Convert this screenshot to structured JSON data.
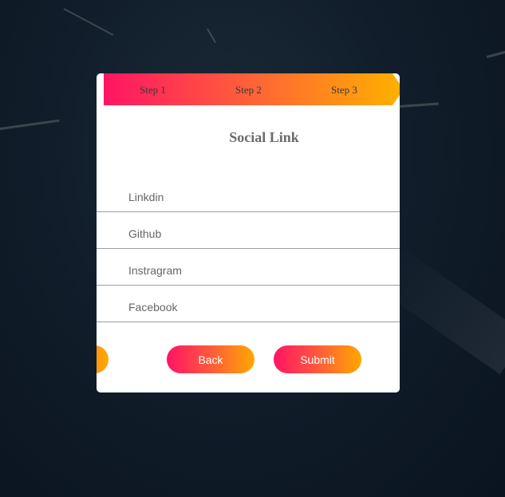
{
  "steps": [
    "Step 1",
    "Step 2",
    "Step 3"
  ],
  "form": {
    "title": "Social Link",
    "fields": [
      {
        "placeholder": "Linkdin",
        "value": ""
      },
      {
        "placeholder": "Github",
        "value": ""
      },
      {
        "placeholder": "Instragram",
        "value": ""
      },
      {
        "placeholder": "Facebook",
        "value": ""
      }
    ]
  },
  "buttons": {
    "back": "Back",
    "submit": "Submit"
  },
  "colors": {
    "gradient_start": "#ff1464",
    "gradient_end": "#ffb000",
    "card": "#ffffff",
    "background": "#0f1b27"
  }
}
